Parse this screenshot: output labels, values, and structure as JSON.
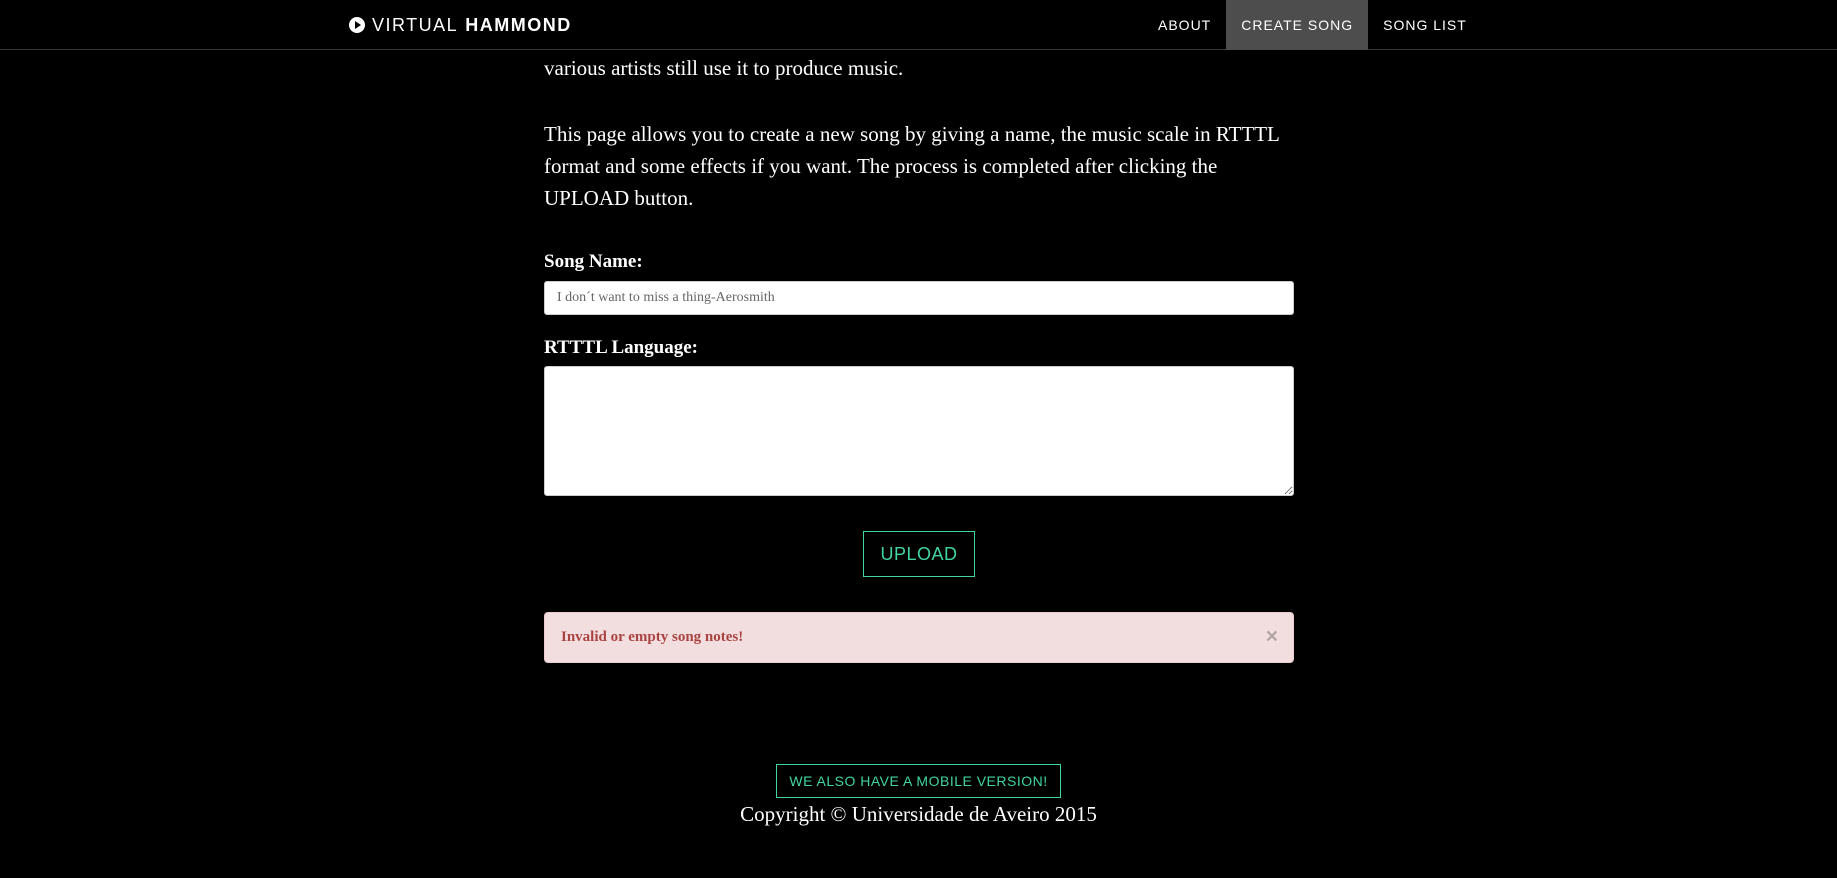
{
  "navbar": {
    "brand_light": "VIRTUAL",
    "brand_bold": "HAMMOND",
    "brand_icon": "play-circle-icon",
    "items": [
      {
        "label": "ABOUT",
        "active": false
      },
      {
        "label": "CREATE SONG",
        "active": true
      },
      {
        "label": "SONG LIST",
        "active": false
      }
    ]
  },
  "content": {
    "intro_tail": "various artists still use it to produce music.",
    "description": "This page allows you to create a new song by giving a name, the music scale in RTTTL format and some effects if you want. The process is completed after clicking the UPLOAD button."
  },
  "form": {
    "song_name_label": "Song Name:",
    "song_name_placeholder": "I don´t want to miss a thing-Aerosmith",
    "song_name_value": "",
    "rtttl_label": "RTTTL Language:",
    "rtttl_value": "",
    "upload_label": "UPLOAD"
  },
  "alert": {
    "message": "Invalid or empty song notes!",
    "close_symbol": "×"
  },
  "footer": {
    "mobile_label": "WE ALSO HAVE A MOBILE VERSION!",
    "copyright": "Copyright © Universidade de Aveiro 2015"
  },
  "colors": {
    "background": "#000000",
    "accent": "#42d4a4",
    "nav_active": "#4d4d4d",
    "alert_bg": "#f2dede",
    "alert_text": "#a94442"
  }
}
